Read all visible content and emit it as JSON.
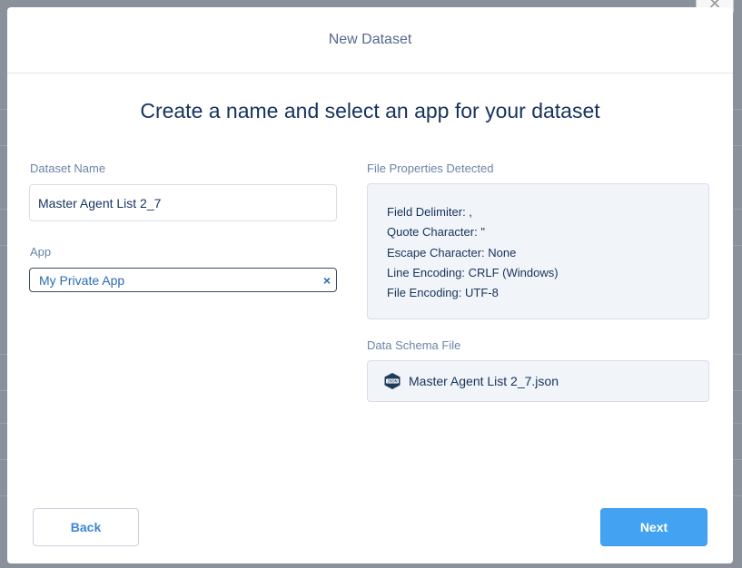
{
  "modal": {
    "title": "New Dataset",
    "heading": "Create a name and select an app for your dataset"
  },
  "left": {
    "dataset_name_label": "Dataset Name",
    "dataset_name_value": "Master Agent List 2_7",
    "app_label": "App",
    "app_value": "My Private App",
    "app_clear_icon": "close-icon",
    "app_clear_glyph": "×"
  },
  "right": {
    "props_label": "File Properties Detected",
    "props": [
      "Field Delimiter: ,",
      "Quote Character: \"",
      "Escape Character: None",
      "Line Encoding: CRLF (Windows)",
      "File Encoding: UTF-8"
    ],
    "schema_label": "Data Schema File",
    "schema_icon": "json-file-icon",
    "schema_icon_text": "JSON",
    "schema_file": "Master Agent List 2_7.json"
  },
  "footer": {
    "back_label": "Back",
    "next_label": "Next"
  },
  "colors": {
    "accent": "#43a2f2",
    "text_dark": "#16325c",
    "label": "#6b84a8",
    "box_bg": "#f1f4f8"
  }
}
